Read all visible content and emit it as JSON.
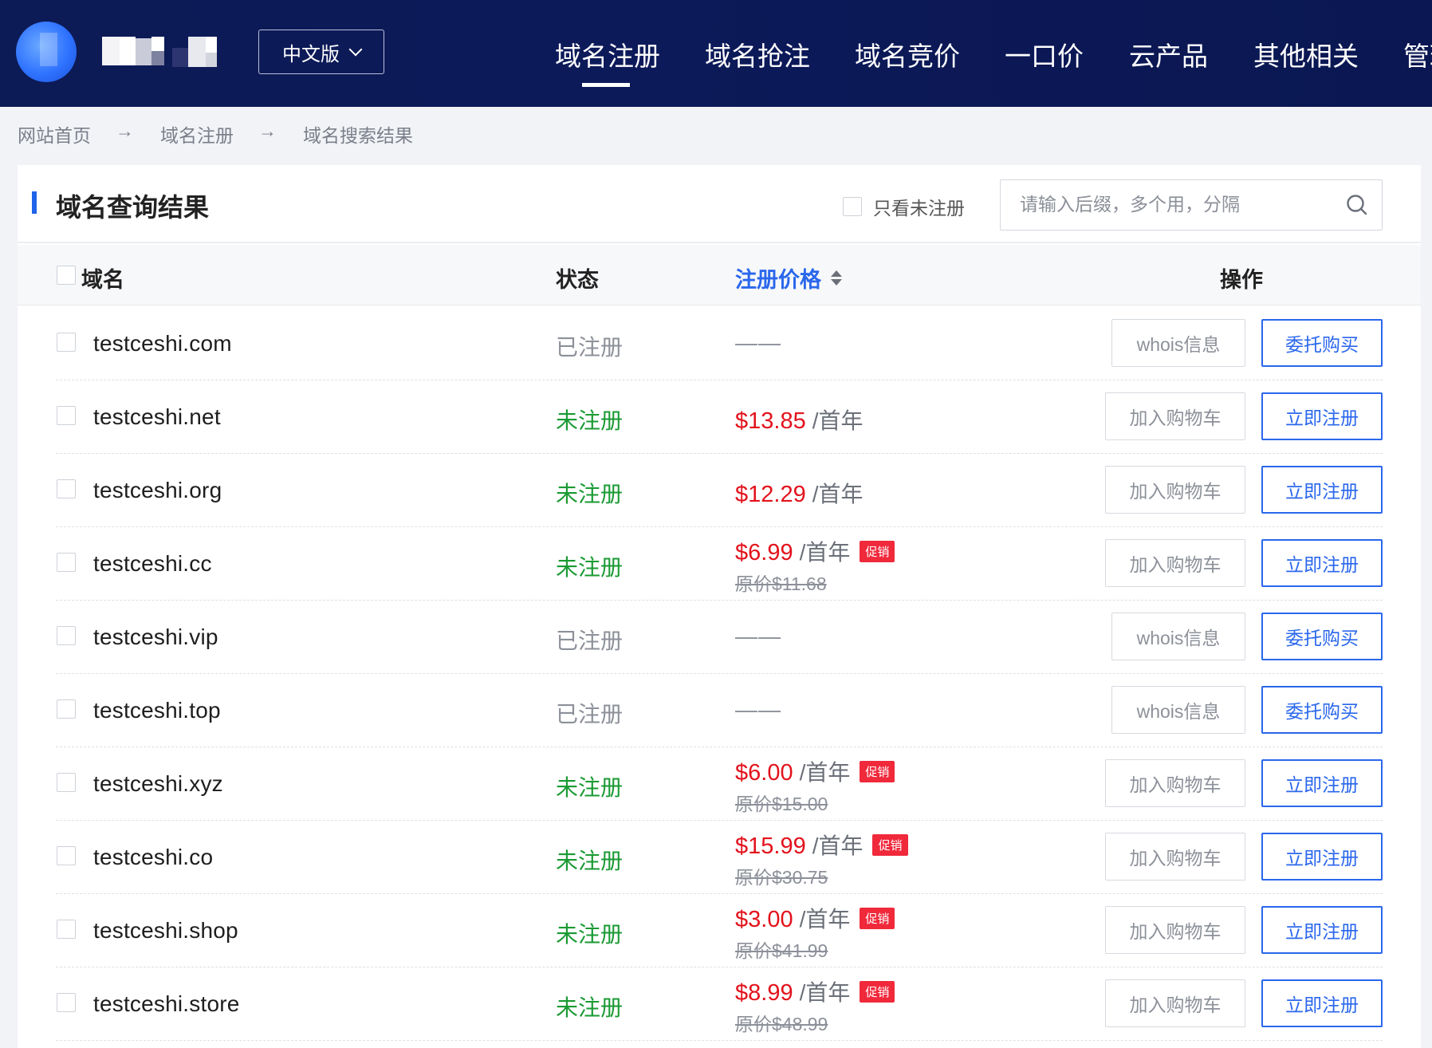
{
  "header": {
    "lang_label": "中文版",
    "nav": [
      "域名注册",
      "域名抢注",
      "域名竞价",
      "一口价",
      "云产品",
      "其他相关",
      "管理"
    ],
    "active_nav": 0
  },
  "breadcrumb": [
    "网站首页",
    "域名注册",
    "域名搜索结果"
  ],
  "breadcrumb_sep": "→",
  "panel": {
    "title": "域名查询结果",
    "only_unregistered_label": "只看未注册",
    "search_placeholder": "请输入后缀，多个用，分隔"
  },
  "table": {
    "headers": {
      "domain": "域名",
      "status": "状态",
      "price": "注册价格",
      "action": "操作"
    },
    "rows": [
      {
        "domain": "testceshi.com",
        "status": "已注册",
        "registered": true,
        "price_text": "——",
        "btn1": "whois信息",
        "btn2": "委托购买"
      },
      {
        "domain": "testceshi.net",
        "status": "未注册",
        "registered": false,
        "price": "$13.85",
        "unit": "/首年",
        "btn1": "加入购物车",
        "btn2": "立即注册"
      },
      {
        "domain": "testceshi.org",
        "status": "未注册",
        "registered": false,
        "price": "$12.29",
        "unit": "/首年",
        "btn1": "加入购物车",
        "btn2": "立即注册"
      },
      {
        "domain": "testceshi.cc",
        "status": "未注册",
        "registered": false,
        "price": "$6.99",
        "unit": "/首年",
        "promo": "促销",
        "original": "原价$11.68",
        "btn1": "加入购物车",
        "btn2": "立即注册"
      },
      {
        "domain": "testceshi.vip",
        "status": "已注册",
        "registered": true,
        "price_text": "——",
        "btn1": "whois信息",
        "btn2": "委托购买"
      },
      {
        "domain": "testceshi.top",
        "status": "已注册",
        "registered": true,
        "price_text": "——",
        "btn1": "whois信息",
        "btn2": "委托购买"
      },
      {
        "domain": "testceshi.xyz",
        "status": "未注册",
        "registered": false,
        "price": "$6.00",
        "unit": "/首年",
        "promo": "促销",
        "original": "原价$15.00",
        "btn1": "加入购物车",
        "btn2": "立即注册"
      },
      {
        "domain": "testceshi.co",
        "status": "未注册",
        "registered": false,
        "price": "$15.99",
        "unit": "/首年",
        "promo": "促销",
        "original": "原价$30.75",
        "btn1": "加入购物车",
        "btn2": "立即注册"
      },
      {
        "domain": "testceshi.shop",
        "status": "未注册",
        "registered": false,
        "price": "$3.00",
        "unit": "/首年",
        "promo": "促销",
        "original": "原价$41.99",
        "btn1": "加入购物车",
        "btn2": "立即注册"
      },
      {
        "domain": "testceshi.store",
        "status": "未注册",
        "registered": false,
        "price": "$8.99",
        "unit": "/首年",
        "promo": "促销",
        "original": "原价$48.99",
        "btn1": "加入购物车",
        "btn2": "立即注册"
      }
    ]
  },
  "colors": {
    "header_bg": "#0c1a55",
    "accent_blue": "#2a67ec",
    "price_red": "#e3121c",
    "unregistered_green": "#1a9a33",
    "registered_gray": "#8c9099",
    "promo_red": "#f0293b"
  },
  "icons": {
    "search": "search-icon",
    "language_dropdown": "chevron-down-icon",
    "sort": "sort-icon"
  }
}
